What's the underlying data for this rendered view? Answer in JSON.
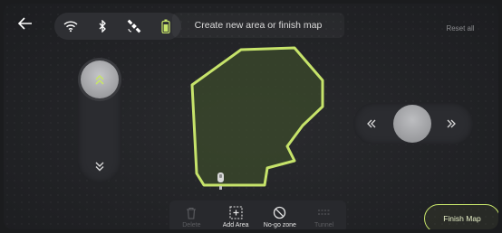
{
  "header": {
    "prompt": "Create new area or finish map",
    "reset_label": "Reset all"
  },
  "status_icons": [
    "wifi-icon",
    "bluetooth-icon",
    "satellite-icon",
    "battery-icon"
  ],
  "controls": {
    "vertical_up": "chevron-double-up-icon",
    "vertical_down": "chevron-double-down-icon",
    "horizontal_left": "«",
    "horizontal_right": "»"
  },
  "toolbar": {
    "delete_label": "Delete",
    "add_area_label": "Add Area",
    "no_go_label": "No-go zone",
    "tunnel_label": "Tunnel"
  },
  "finish_label": "Finish Map",
  "colors": {
    "accent": "#c6e36a",
    "area_fill": "#3b4a2b",
    "background": "#222326"
  }
}
